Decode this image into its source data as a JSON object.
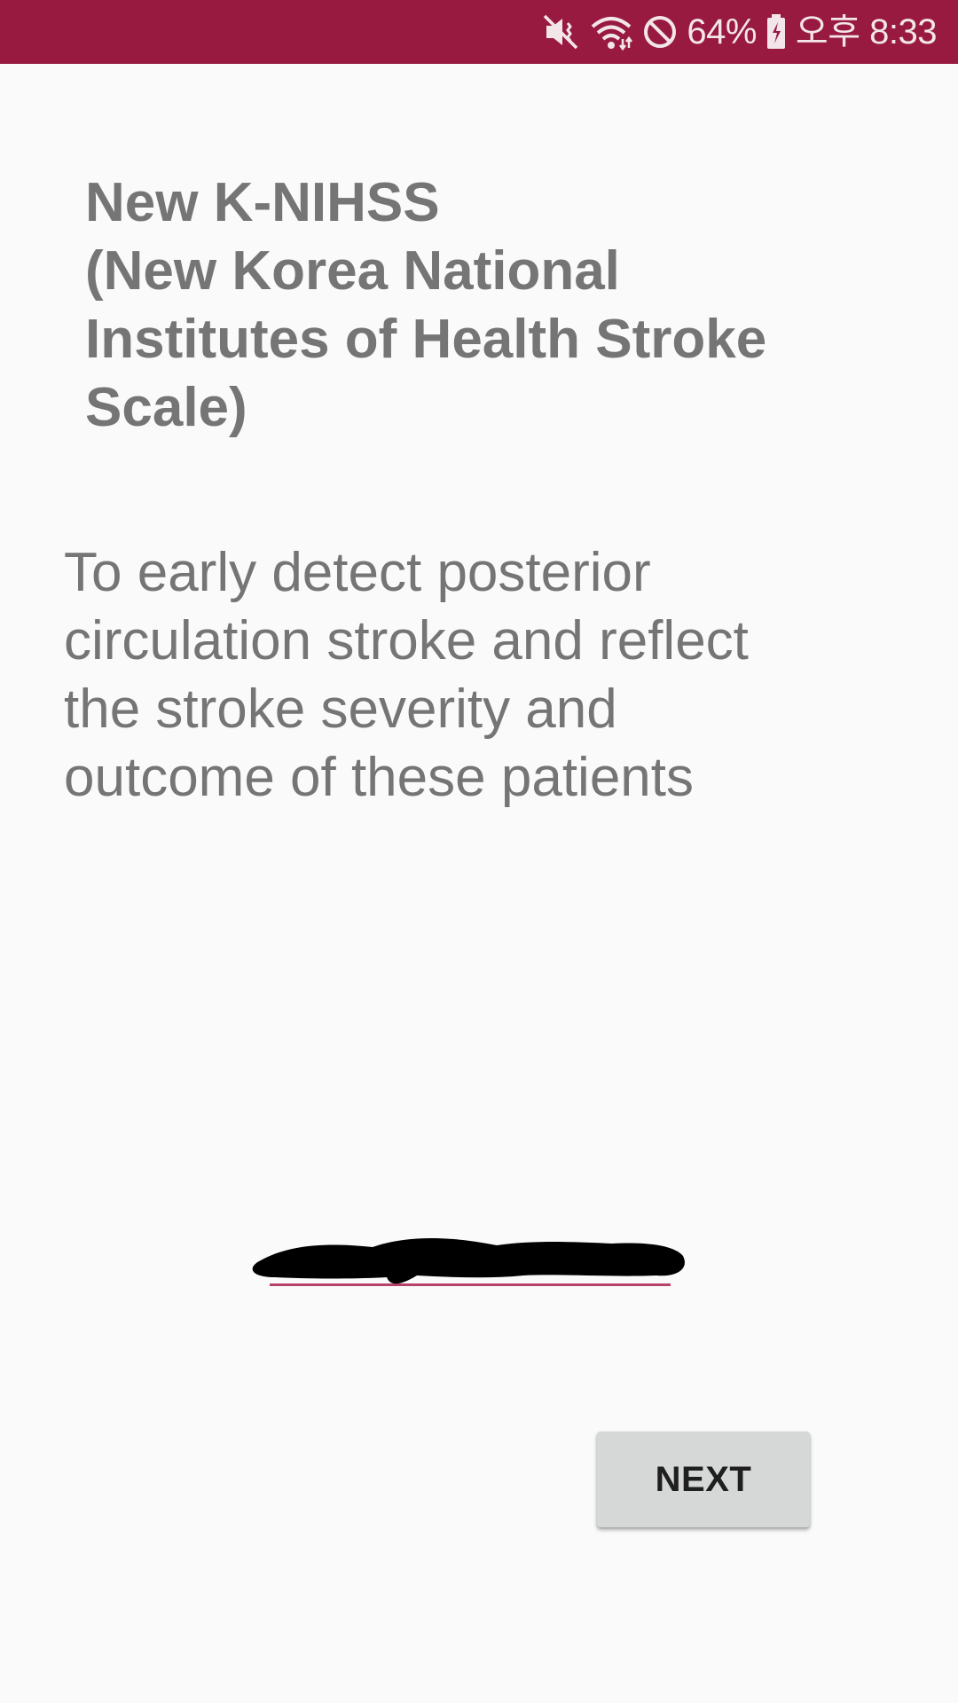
{
  "status_bar": {
    "background_color": "#981a40",
    "icons": [
      "mute-vibrate-icon",
      "wifi-icon",
      "do-not-disturb-icon",
      "battery-charging-icon"
    ],
    "battery_percent": "64%",
    "time": "오후 8:33"
  },
  "title_lines": [
    "New K-NIHSS",
    "(New Korea National",
    "Institutes of Health Stroke",
    "Scale)"
  ],
  "description_lines": [
    "To early detect posterior",
    "circulation stroke and reflect",
    "the stroke severity and",
    "outcome of these patients"
  ],
  "redacted_link": {
    "accent_color": "#b6426a"
  },
  "next_button": {
    "label": "NEXT"
  },
  "colors": {
    "accent": "#981a40",
    "text_gray": "#757575",
    "background": "#fafafa",
    "button_bg": "#d6d7d7"
  }
}
